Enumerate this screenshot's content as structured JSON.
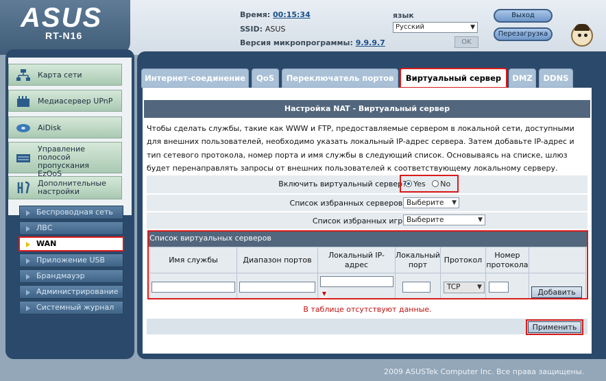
{
  "header": {
    "brand": "ASUS",
    "model": "RT-N16",
    "time_label": "Время:",
    "time_value": "00:15:34",
    "ssid_label": "SSID:",
    "ssid_value": "ASUS",
    "firmware_label": "Версия микропрограммы:",
    "firmware_value": "9.9.9.7",
    "lang_label": "язык",
    "lang_value": "Русский",
    "ok_label": "OK",
    "logout_label": "Выход",
    "reboot_label": "Перезагрузка"
  },
  "sidebar": {
    "menu": [
      {
        "label": "Карта сети"
      },
      {
        "label": "Медиасервер UPnP"
      },
      {
        "label": "AiDisk"
      },
      {
        "label": "Управление полосой пропускания EzQoS"
      },
      {
        "label": "Дополнительные настройки"
      }
    ],
    "sub": [
      {
        "label": "Беспроводная сеть"
      },
      {
        "label": "ЛВС"
      },
      {
        "label": "WAN"
      },
      {
        "label": "Приложение USB"
      },
      {
        "label": "Брандмауэр"
      },
      {
        "label": "Администрирование"
      },
      {
        "label": "Системный журнал"
      }
    ]
  },
  "tabs": [
    {
      "label": "Интернет-соединение"
    },
    {
      "label": "QoS"
    },
    {
      "label": "Переключатель портов"
    },
    {
      "label": "Виртуальный сервер"
    },
    {
      "label": "DMZ"
    },
    {
      "label": "DDNS"
    }
  ],
  "main": {
    "title": "Настройка NAT - Виртуальный сервер",
    "description": "Чтобы сделать службы, такие как WWW и FTP, предоставляемые сервером в локальной сети, доступными для внешних пользователей, необходимо указать локальный IP-адрес сервера. Затем добавьте IP-адрес и тип сетевого протокола, номер порта и имя службы в следующий список. Основываясь на списке, шлюз будет перенаправлять запросы от внешних пользователей к соответствующему локальному серверу.",
    "enable_label": "Включить виртуальный сервер?",
    "yes_label": "Yes",
    "no_label": "No",
    "fav_servers_label": "Список избранных серверов:",
    "fav_servers_value": "Выберите",
    "fav_games_label": "Список избранных игр:",
    "fav_games_value": "Выберите",
    "list_title": "Список виртуальных серверов",
    "columns": [
      "Имя службы",
      "Диапазон портов",
      "Локальный IP-адрес",
      "Локальный порт",
      "Протокол",
      "Номер протокола"
    ],
    "protocol_value": "TCP",
    "add_label": "Добавить",
    "no_data": "В таблице отсутствуют данные.",
    "apply_label": "Применить"
  },
  "footer": "2009 ASUSTek Computer Inc. Все права защищены."
}
